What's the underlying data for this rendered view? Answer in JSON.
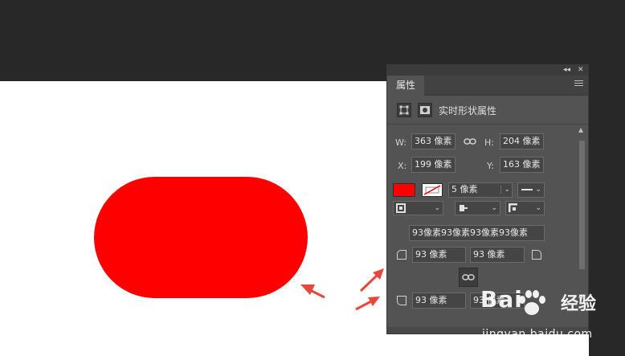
{
  "panel": {
    "tab_label": "属性",
    "collapse_icon": "◂◂",
    "close_icon": "✕",
    "section_title": "实时形状属性",
    "w_label": "W:",
    "w_value": "363 像素",
    "h_label": "H:",
    "h_value": "204 像素",
    "x_label": "X:",
    "x_value": "199 像素",
    "y_label": "Y:",
    "y_value": "163 像素",
    "fill_color": "#fe0000",
    "stroke_width": "5 像素",
    "all_corners_value": "93像素93像素93像素93像素",
    "corner_tl_value": "93 像素",
    "corner_tr_value": "93 像素",
    "corner_bl_value": "93 像素",
    "corner_br_value": "93 像素"
  },
  "canvas": {
    "shape_color": "#fe0000",
    "arrow_color": "#e8483c"
  },
  "watermark": {
    "brand": "Bai",
    "brand_suffix": "经验",
    "url": "jingyan.baidu.com"
  }
}
